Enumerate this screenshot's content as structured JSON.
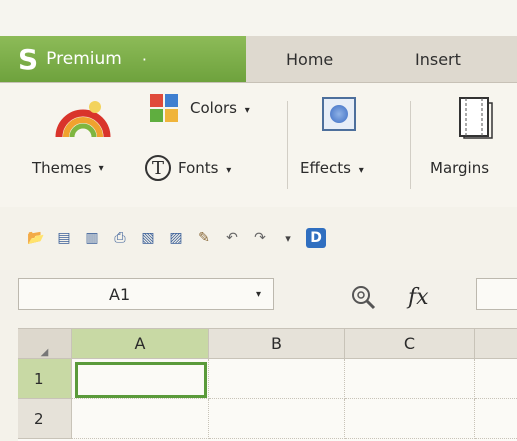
{
  "tabs": {
    "premium": {
      "logo": "S",
      "label": "Premium",
      "dot": "·"
    },
    "home": "Home",
    "insert": "Insert"
  },
  "ribbon": {
    "themes": {
      "label": "Themes",
      "icon": "rainbow-icon"
    },
    "colors": {
      "label": "Colors",
      "icon": "color-palette-icon"
    },
    "fonts": {
      "label": "Fonts",
      "glyph": "T",
      "icon": "font-icon"
    },
    "effects": {
      "label": "Effects",
      "icon": "effects-icon"
    },
    "margins": {
      "label": "Margins",
      "icon": "page-margins-icon"
    },
    "caret": "▾"
  },
  "quick_access": [
    {
      "icon": "open-folder-icon",
      "glyph": "📂"
    },
    {
      "icon": "save-icon",
      "glyph": "▤"
    },
    {
      "icon": "save-as-icon",
      "glyph": "▥"
    },
    {
      "icon": "print-icon",
      "glyph": "⎙"
    },
    {
      "icon": "print-preview-icon",
      "glyph": "▧"
    },
    {
      "icon": "spell-check-icon",
      "glyph": "▨"
    },
    {
      "icon": "format-painter-icon",
      "glyph": "✎"
    },
    {
      "icon": "undo-icon",
      "glyph": "↶"
    },
    {
      "icon": "redo-icon",
      "glyph": "↷"
    },
    {
      "icon": "qat-dropdown-icon",
      "glyph": "▾"
    },
    {
      "icon": "app-logo-icon",
      "glyph": "D"
    }
  ],
  "formula_bar": {
    "name_box_value": "A1",
    "fx": "fx",
    "caret": "▾"
  },
  "grid": {
    "columns": [
      "A",
      "B",
      "C"
    ],
    "rows": [
      "1",
      "2"
    ],
    "selected_cell": "A1",
    "corner_glyph": "◢"
  },
  "colors": {
    "premium_green": "#7aad45",
    "selection_green": "#5a9a3a",
    "header_highlight": "#c8d9a4"
  }
}
